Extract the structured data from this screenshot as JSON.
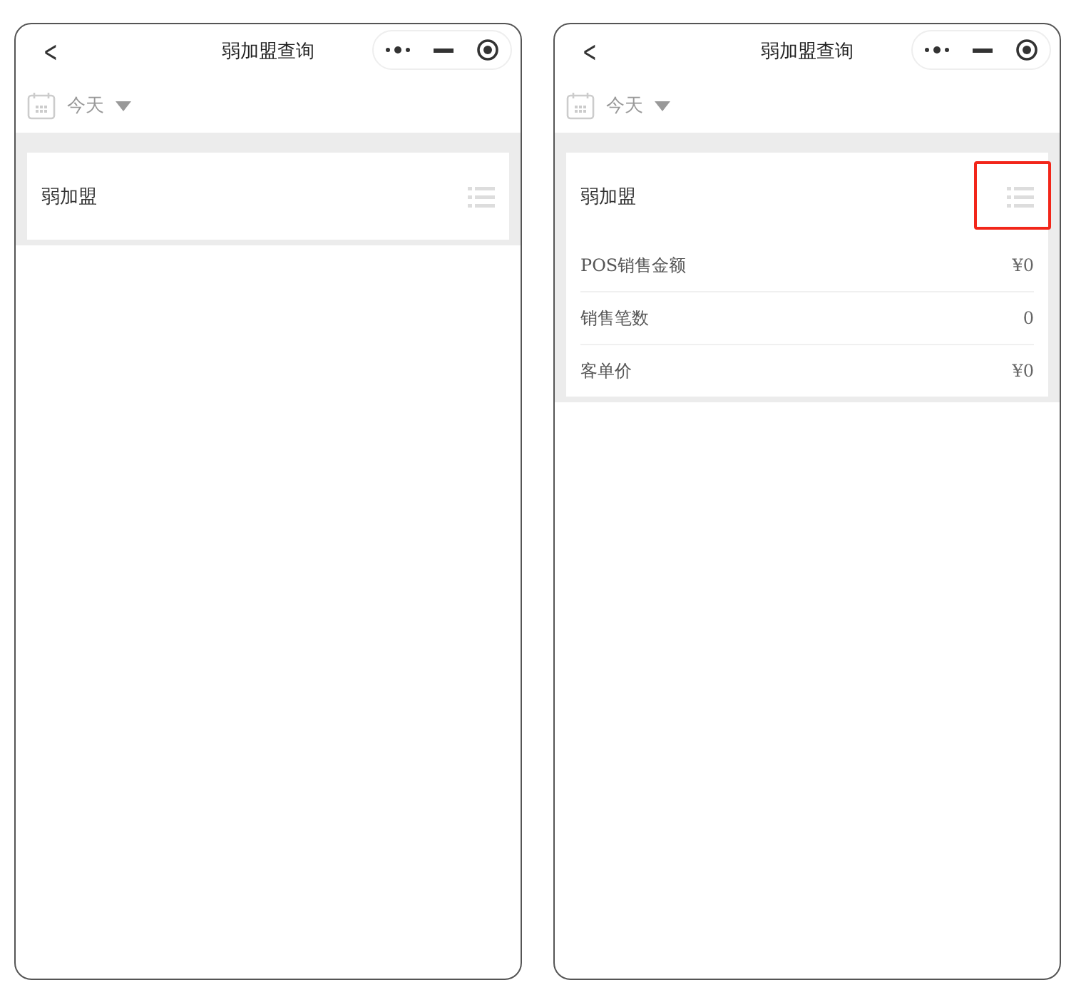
{
  "screens": [
    {
      "nav": {
        "back": "<",
        "title": "弱加盟查询"
      },
      "filter": {
        "label": "今天"
      },
      "card": {
        "title": "弱加盟",
        "highlighted": false
      }
    },
    {
      "nav": {
        "back": "<",
        "title": "弱加盟查询"
      },
      "filter": {
        "label": "今天"
      },
      "card": {
        "title": "弱加盟",
        "highlighted": true,
        "rows": [
          {
            "label": "POS销售金额",
            "value": "¥0"
          },
          {
            "label": "销售笔数",
            "value": "0"
          },
          {
            "label": "客单价",
            "value": "¥0"
          }
        ]
      }
    }
  ]
}
